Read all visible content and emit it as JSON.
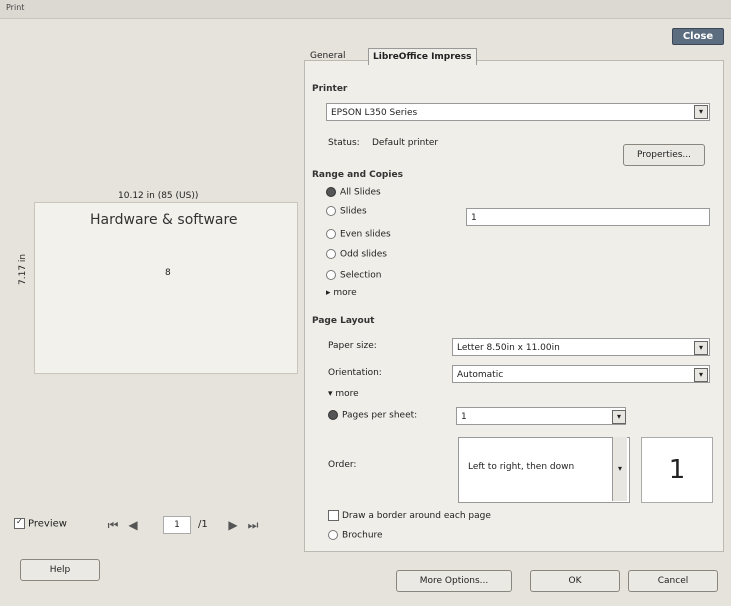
{
  "window": {
    "title": "Print",
    "close_label": "Close"
  },
  "preview": {
    "width_label": "10.12 in (85 (US))",
    "height_label": "7.17 in",
    "slide_title": "Hardware & software",
    "slide_number": "8",
    "preview_checkbox_label": "Preview",
    "current_page": "1",
    "total_pages": "/1"
  },
  "tabs": {
    "general": "General",
    "impress": "LibreOffice Impress"
  },
  "printer": {
    "section": "Printer",
    "selected": "EPSON L350 Series",
    "status_label": "Status:",
    "status_value": "Default printer",
    "properties_button": "Properties..."
  },
  "range": {
    "section": "Range and Copies",
    "options": [
      {
        "label": "All Slides",
        "selected": true
      },
      {
        "label": "Slides",
        "selected": false
      },
      {
        "label": "Even slides",
        "selected": false
      },
      {
        "label": "Odd slides",
        "selected": false
      },
      {
        "label": "Selection",
        "selected": false
      }
    ],
    "more_label": "more",
    "slides_value": "1"
  },
  "layout": {
    "section": "Page Layout",
    "paper_size_label": "Paper size:",
    "paper_size_value": "Letter 8.50in x 11.00in",
    "orientation_label": "Orientation:",
    "orientation_value": "Automatic",
    "more_label": "more",
    "pages_per_sheet_label": "Pages per sheet:",
    "pages_per_sheet_value": "1",
    "order_label": "Order:",
    "order_value": "Left to right, then down",
    "order_preview": "1",
    "border_label": "Draw a border around each page",
    "brochure_label": "Brochure"
  },
  "buttons": {
    "help": "Help",
    "more_options": "More Options...",
    "ok": "OK",
    "cancel": "Cancel"
  }
}
